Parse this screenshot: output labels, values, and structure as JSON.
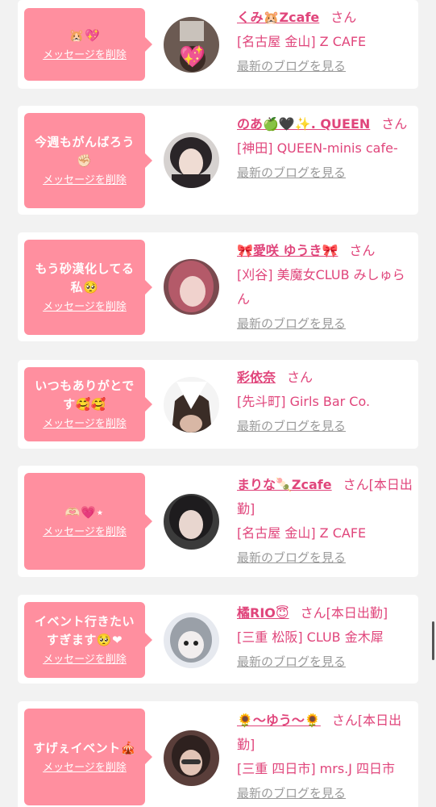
{
  "colors": {
    "accent": "#ff8f9f",
    "name_text": "#e0457b",
    "link_gray": "#9a9a9a",
    "background": "#f2f2f2"
  },
  "delete_label": "メッセージを削除",
  "blog_label": "最新のブログを見る",
  "san_label": "さん",
  "entries": [
    {
      "message": "🐹💖",
      "name": "くみ🐹Zcafe",
      "suffix": "",
      "shop": "[名古屋 金山] Z CAFE"
    },
    {
      "message": "今週もがんばろう✊🏻",
      "name": "のあ🍏🖤✨. QUEEN",
      "suffix": "",
      "shop": "[神田] QUEEN-minis cafe-"
    },
    {
      "message": "もう砂漠化してる私🥺",
      "name": "🎀愛咲 ゆうき🎀",
      "suffix": "",
      "shop": "[刈谷] 美魔女CLUB みしゅらん"
    },
    {
      "message": "いつもありがとです🥰🥰",
      "name": "彩依奈",
      "suffix": "",
      "shop": "[先斗町] Girls Bar Co."
    },
    {
      "message": "🫶🏻💗⋆",
      "name": "まりな🍡Zcafe",
      "suffix": "[本日出勤]",
      "shop": "[名古屋 金山] Z CAFE"
    },
    {
      "message": "イベント行きたいすぎます🥺❤︎",
      "name": "橘RIO😇",
      "suffix": "[本日出勤]",
      "shop": "[三重 松阪] CLUB 金木犀"
    },
    {
      "message": "すげぇイベント🎪",
      "name": "🌻〜ゆう〜🌻",
      "suffix": "[本日出勤]",
      "shop": "[三重 四日市] mrs.J 四日市"
    }
  ]
}
